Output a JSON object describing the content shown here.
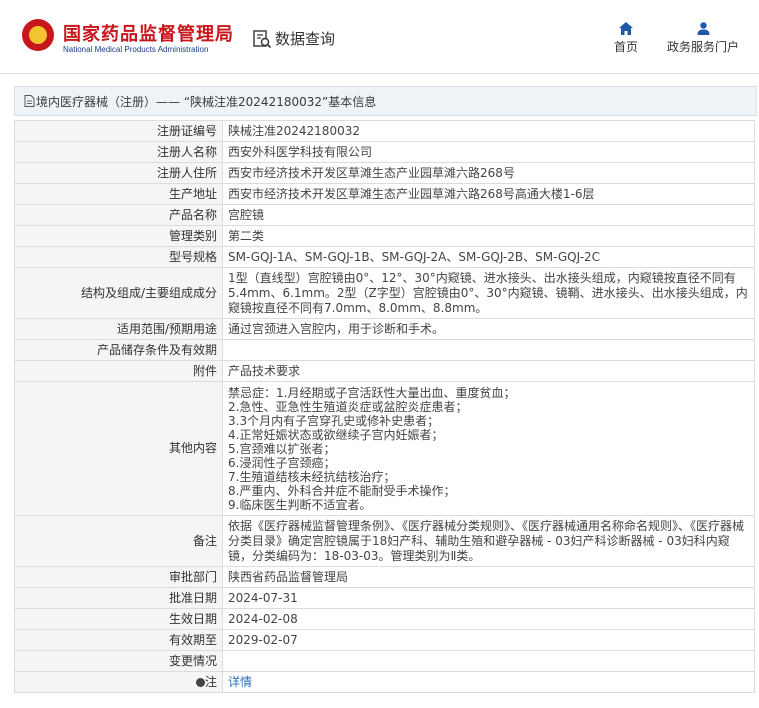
{
  "header": {
    "site_name_cn": "国家药品监督管理局",
    "site_name_en": "National Medical Products Administration",
    "data_query_label": "数据查询",
    "nav": {
      "home": "首页",
      "service": "政务服务门户"
    }
  },
  "breadcrumb": "境内医疗器械（注册）—— “陕械注准20242180032”基本信息",
  "rows": [
    {
      "label": "注册证编号",
      "value": "陕械注准20242180032"
    },
    {
      "label": "注册人名称",
      "value": "西安外科医学科技有限公司"
    },
    {
      "label": "注册人住所",
      "value": "西安市经济技术开发区草滩生态产业园草滩六路268号"
    },
    {
      "label": "生产地址",
      "value": "西安市经济技术开发区草滩生态产业园草滩六路268号高通大楼1-6层"
    },
    {
      "label": "产品名称",
      "value": "宫腔镜"
    },
    {
      "label": "管理类别",
      "value": "第二类"
    },
    {
      "label": "型号规格",
      "value": "SM-GQJ-1A、SM-GQJ-1B、SM-GQJ-2A、SM-GQJ-2B、SM-GQJ-2C"
    },
    {
      "label": "结构及组成/主要组成成分",
      "value": "1型（直线型）宫腔镜由0°、12°、30°内窥镜、进水接头、出水接头组成，内窥镜按直径不同有5.4mm、6.1mm。2型（Z字型）宫腔镜由0°、30°内窥镜、镜鞘、进水接头、出水接头组成，内窥镜按直径不同有7.0mm、8.0mm、8.8mm。"
    },
    {
      "label": "适用范围/预期用途",
      "value": "通过宫颈进入宫腔内，用于诊断和手术。"
    },
    {
      "label": "产品储存条件及有效期",
      "value": ""
    },
    {
      "label": "附件",
      "value": "产品技术要求"
    },
    {
      "label": "其他内容",
      "value": "禁忌症：1.月经期或子宫活跃性大量出血、重度贫血；\n2.急性、亚急性生殖道炎症或盆腔炎症患者；\n3.3个月内有子宫穿孔史或修补史患者；\n4.正常妊娠状态或欲继续子宫内妊娠者；\n5.宫颈难以扩张者；\n6.浸润性子宫颈癌；\n7.生殖道结核未经抗结核治疗；\n8.严重内、外科合并症不能耐受手术操作；\n9.临床医生判断不适宜者。"
    },
    {
      "label": "备注",
      "value": "依据《医疗器械监督管理条例》、《医疗器械分类规则》、《医疗器械通用名称命名规则》、《医疗器械分类目录》确定宫腔镜属于18妇产科、辅助生殖和避孕器械 - 03妇产科诊断器械 - 03妇科内窥镜，分类编码为：18-03-03。管理类别为Ⅱ类。"
    },
    {
      "label": "审批部门",
      "value": "陕西省药品监督管理局"
    },
    {
      "label": "批准日期",
      "value": "2024-07-31"
    },
    {
      "label": "生效日期",
      "value": "2024-02-08"
    },
    {
      "label": "有效期至",
      "value": "2029-02-07"
    },
    {
      "label": "变更情况",
      "value": ""
    },
    {
      "label": "注",
      "value": "详情"
    }
  ]
}
